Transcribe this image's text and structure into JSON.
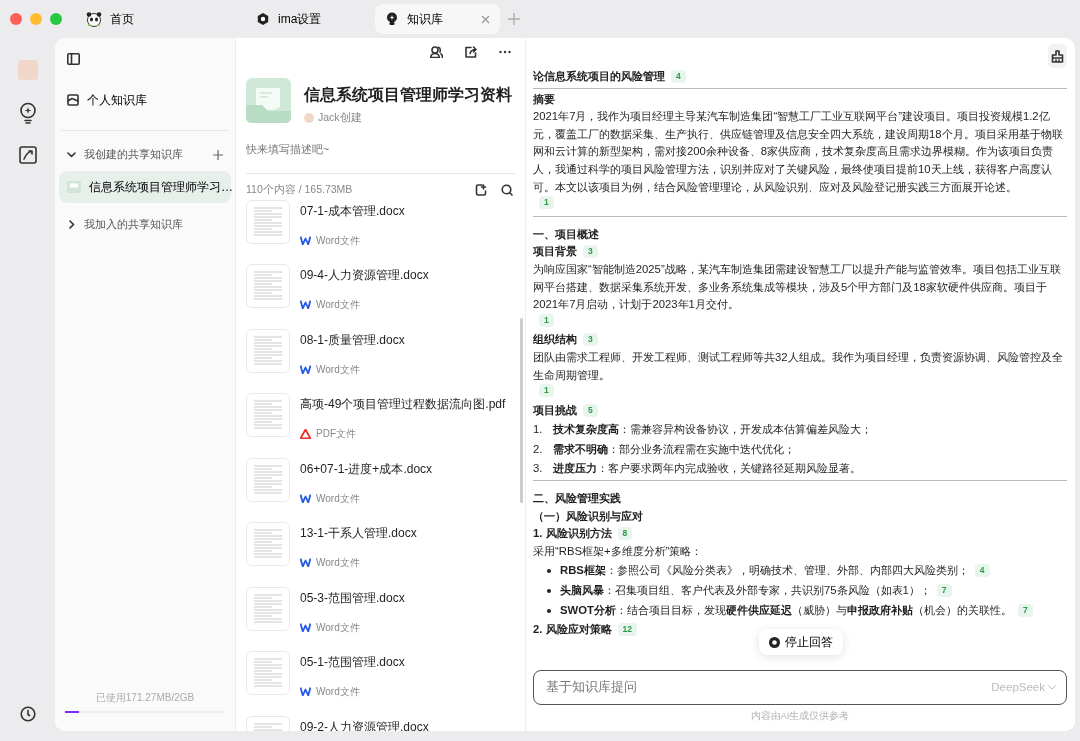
{
  "tabs": [
    {
      "label": "首页",
      "kind": "panda",
      "selected": false
    },
    {
      "label": "ima设置",
      "kind": "settings",
      "selected": false
    },
    {
      "label": "知识库",
      "kind": "bulb",
      "selected": true
    }
  ],
  "sidebar": {
    "personal": "个人知识库",
    "sections": [
      {
        "label": "我创建的共享知识库",
        "expanded": true,
        "items": [
          {
            "label": "信息系统项目管理师学习…",
            "selected": true
          }
        ]
      },
      {
        "label": "我加入的共享知识库",
        "expanded": false
      }
    ],
    "storage": {
      "text": "已使用171.27MB/2GB",
      "level": 0.085
    }
  },
  "knowledge_base": {
    "title": "信息系统项目管理师学习资料",
    "creator": "Jack创建",
    "description_placeholder": "快来填写描述吧~",
    "summary": "110个内容 / 165.73MB",
    "files": [
      {
        "name": "07-1-成本管理.docx",
        "kind": "word",
        "type": "Word文件"
      },
      {
        "name": "09-4-人力资源管理.docx",
        "kind": "word",
        "type": "Word文件"
      },
      {
        "name": "08-1-质量管理.docx",
        "kind": "word",
        "type": "Word文件"
      },
      {
        "name": "高项-49个项目管理过程数据流向图.pdf",
        "kind": "pdf",
        "type": "PDF文件"
      },
      {
        "name": "06+07-1-进度+成本.docx",
        "kind": "word",
        "type": "Word文件"
      },
      {
        "name": "13-1-干系人管理.docx",
        "kind": "word",
        "type": "Word文件"
      },
      {
        "name": "05-3-范围管理.docx",
        "kind": "word",
        "type": "Word文件"
      },
      {
        "name": "05-1-范围管理.docx",
        "kind": "word",
        "type": "Word文件"
      },
      {
        "name": "09-2-人力资源管理.docx"
      }
    ]
  },
  "document": {
    "blocks": [
      {
        "kind": "title",
        "text": "论信息系统项目的风险管理",
        "cite": "4"
      },
      {
        "kind": "rule"
      },
      {
        "kind": "heading",
        "text": "摘要"
      },
      {
        "kind": "paragraph",
        "text": "2021年7月，我作为项目经理主导某汽车制造集团“智慧工厂工业互联网平台”建设项目。项目投资规模1.2亿元，覆盖工厂的数据采集、生产执行、供应链管理及信息安全四大系统，建设周期18个月。项目采用基于物联网和云计算的新型架构，需对接200余种设备、8家供应商，技术复杂度高且需求边界模糊。作为该项目负责人，我通过科学的项目风险管理方法，识别并应对了关键风险，最终使项目提前10天上线，获得客户高度认可。本文以该项目为例，结合风险管理理论，从风险识别、应对及风险登记册实践三方面展开论述。",
        "cite": "1"
      },
      {
        "kind": "rule"
      },
      {
        "kind": "section",
        "text": "一、项目概述"
      },
      {
        "kind": "heading",
        "text": "项目背景",
        "cite": "3"
      },
      {
        "kind": "paragraph",
        "text": "为响应国家“智能制造2025”战略，某汽车制造集团需建设智慧工厂以提升产能与监管效率。项目包括工业互联网平台搭建、数据采集系统开发、多业务系统集成等模块，涉及5个甲方部门及18家软硬件供应商。项目于2021年7月启动，计划于2023年1月交付。",
        "cite": "1"
      },
      {
        "kind": "heading",
        "text": "组织结构",
        "cite": "3"
      },
      {
        "kind": "paragraph",
        "text": "团队由需求工程师、开发工程师、测试工程师等共32人组成。我作为项目经理，负责资源协调、风险管控及全生命周期管理。",
        "cite": "1"
      },
      {
        "kind": "heading",
        "text": "项目挑战",
        "cite": "5"
      },
      {
        "kind": "numbered",
        "marker": "1.",
        "text": "**技术复杂度高**：需兼容异构设备协议，开发成本估算偏差风险大；"
      },
      {
        "kind": "numbered",
        "marker": "2.",
        "text": "**需求不明确**：部分业务流程需在实施中迭代优化；"
      },
      {
        "kind": "numbered",
        "marker": "3.",
        "text": "**进度压力**：客户要求两年内完成验收，关键路径延期风险显著。"
      },
      {
        "kind": "rule"
      },
      {
        "kind": "section",
        "text": "二、风险管理实践"
      },
      {
        "kind": "heading",
        "text": "（一）风险识别与应对"
      },
      {
        "kind": "heading",
        "text": "1. 风险识别方法",
        "cite": "8"
      },
      {
        "kind": "paragraph",
        "text": "采用“RBS框架+多维度分析”策略："
      },
      {
        "kind": "bullet",
        "text": "**RBS框架**：参照公司《风险分类表》，明确技术、管理、外部、内部四大风险类别；",
        "cite": "4"
      },
      {
        "kind": "bullet",
        "text": "**头脑风暴**：召集项目组、客户代表及外部专家，共识别75条风险（如表1）；",
        "cite": "7"
      },
      {
        "kind": "bullet",
        "text": "**SWOT分析**：结合项目目标，发现**硬件供应延迟**（威胁）与**申报政府补贴**（机会）的关联性。",
        "cite": "7"
      },
      {
        "kind": "heading",
        "text": "2. 风险应对策略",
        "cite": "12"
      }
    ],
    "stop_button": "停止回答",
    "input": {
      "placeholder": "基于知识库提问",
      "model": "DeepSeek"
    },
    "disclaimer": "内容由AI生成仅供参考"
  }
}
